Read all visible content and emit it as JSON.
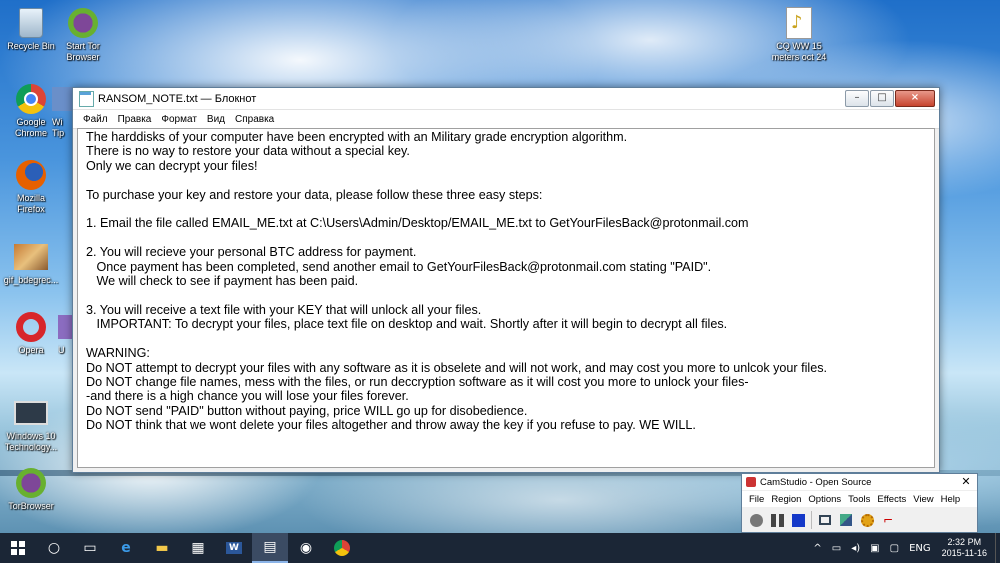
{
  "desktop_icons": [
    {
      "name": "recycle-bin",
      "label": "Recycle Bin",
      "icon": "recycle-bin-icon"
    },
    {
      "name": "start-tor-browser",
      "label": "Start Tor\nBrowser",
      "icon": "tor-icon"
    },
    {
      "name": "google-chrome",
      "label": "Google\nChrome",
      "icon": "chrome-icon"
    },
    {
      "name": "mozilla-firefox",
      "label": "Mozilla\nFirefox",
      "icon": "firefox-icon"
    },
    {
      "name": "gif-file",
      "label": "gif_bdegrec...",
      "icon": "gif-icon"
    },
    {
      "name": "opera",
      "label": "Opera",
      "icon": "opera-icon"
    },
    {
      "name": "windows10-technology",
      "label": "Windows 10\nTechnology...",
      "icon": "video-icon"
    },
    {
      "name": "tor-browser",
      "label": "TorBrowser",
      "icon": "tor-icon"
    },
    {
      "name": "audio-file",
      "label": "CQ WW 15\nmeters oct 24",
      "icon": "audio-file-icon"
    },
    {
      "name": "partial-icon-wi",
      "label": "Wi\nTip"
    },
    {
      "name": "partial-icon-u",
      "label": "U"
    }
  ],
  "notepad": {
    "title": "RANSOM_NOTE.txt — Блокнот",
    "menu": [
      "Файл",
      "Правка",
      "Формат",
      "Вид",
      "Справка"
    ],
    "text": "The harddisks of your computer have been encrypted with an Military grade encryption algorithm.\nThere is no way to restore your data without a special key.\nOnly we can decrypt your files!\n\nTo purchase your key and restore your data, please follow these three easy steps:\n\n1. Email the file called EMAIL_ME.txt at C:\\Users\\Admin/Desktop/EMAIL_ME.txt to GetYourFilesBack@protonmail.com\n\n2. You will recieve your personal BTC address for payment.\n   Once payment has been completed, send another email to GetYourFilesBack@protonmail.com stating \"PAID\".\n   We will check to see if payment has been paid.\n\n3. You will receive a text file with your KEY that will unlock all your files.\n   IMPORTANT: To decrypt your files, place text file on desktop and wait. Shortly after it will begin to decrypt all files.\n\nWARNING:\nDo NOT attempt to decrypt your files with any software as it is obselete and will not work, and may cost you more to unlcok your files.\nDo NOT change file names, mess with the files, or run deccryption software as it will cost you more to unlock your files-\n-and there is a high chance you will lose your files forever.\nDo NOT send \"PAID\" button without paying, price WILL go up for disobedience.\nDo NOT think that we wont delete your files altogether and throw away the key if you refuse to pay. WE WILL."
  },
  "camstudio": {
    "title": "CamStudio - Open Source",
    "menu": [
      "File",
      "Region",
      "Options",
      "Tools",
      "Effects",
      "View",
      "Help"
    ]
  },
  "taskbar": {
    "language": "ENG",
    "time": "2:32 PM",
    "date": "2015-11-16"
  }
}
